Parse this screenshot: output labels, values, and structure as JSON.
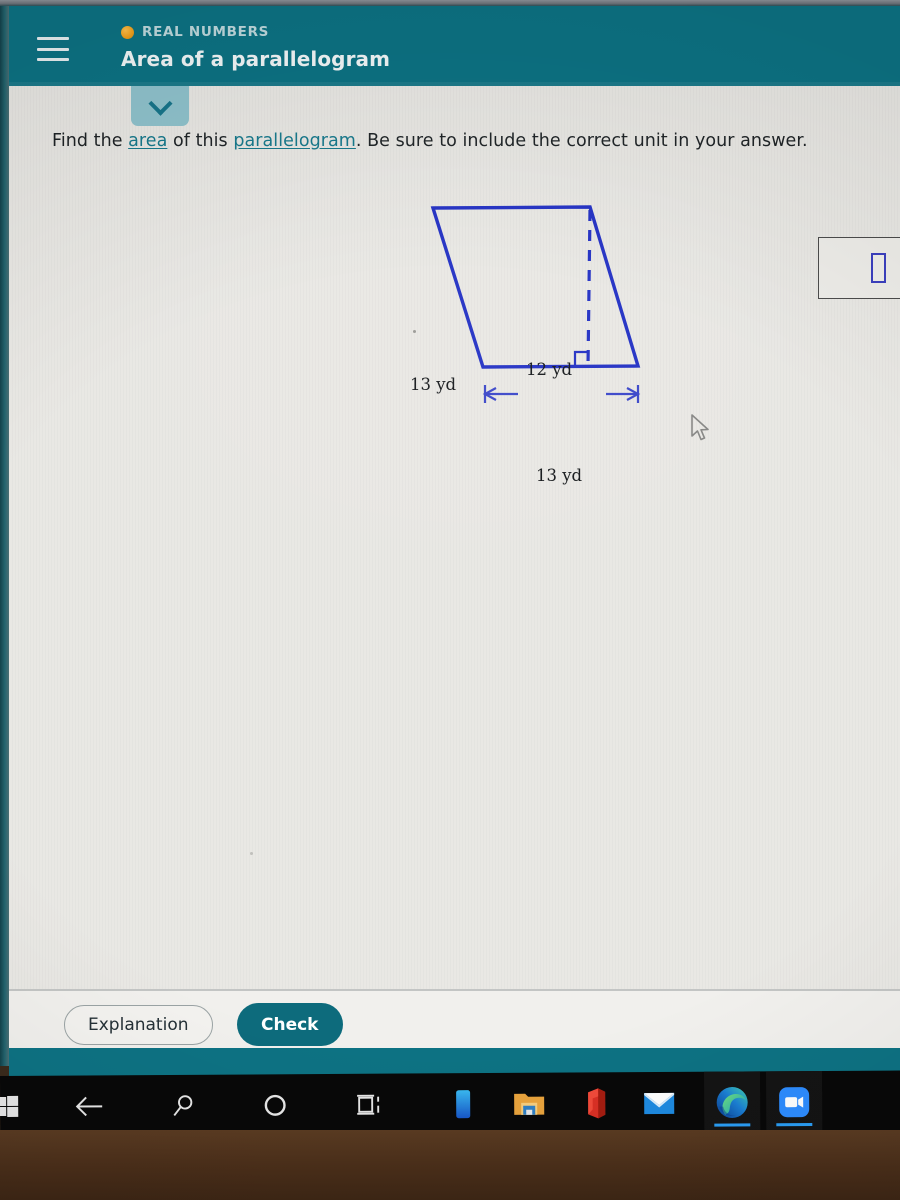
{
  "header": {
    "kicker": "REAL NUMBERS",
    "kicker_icon": "orange-circle-icon",
    "title": "Area of a parallelogram",
    "menu_icon": "hamburger-menu-icon",
    "bg_color": "#0d7283"
  },
  "tab": {
    "icon": "chevron-down-icon",
    "bg_color": "#8fc2cc"
  },
  "prompt": {
    "part1": "Find the ",
    "link1": "area",
    "part2": " of this ",
    "link2": "parallelogram",
    "part3": ". Be sure to include the correct unit in your answer.",
    "link_color": "#17798c"
  },
  "figure": {
    "shape": "parallelogram",
    "stroke_color": "#2331c4",
    "side_label": "13 yd",
    "height_label": "12 yd",
    "base_label": "13 yd",
    "right_angle_marker": "right-angle-icon",
    "height_line_style": "dashed",
    "dimension_arrows": "double-headed-arrow"
  },
  "answer": {
    "value": "",
    "placeholder": "",
    "caret_color": "#3b3fbe"
  },
  "actions": {
    "explanation_label": "Explanation",
    "check_label": "Check",
    "check_bg": "#0d6b7c"
  },
  "taskbar": {
    "items": [
      {
        "name": "windows-start-icon",
        "label": "Start"
      },
      {
        "name": "back-arrow-icon",
        "label": "Back"
      },
      {
        "name": "search-icon",
        "label": "Search"
      },
      {
        "name": "cortana-circle-icon",
        "label": "Cortana"
      },
      {
        "name": "task-view-icon",
        "label": "Task View"
      },
      {
        "name": "your-phone-icon",
        "label": "Your Phone"
      },
      {
        "name": "file-explorer-icon",
        "label": "File Explorer"
      },
      {
        "name": "microsoft-office-icon",
        "label": "Office"
      },
      {
        "name": "mail-icon",
        "label": "Mail"
      },
      {
        "name": "microsoft-edge-icon",
        "label": "Microsoft Edge",
        "active": true
      },
      {
        "name": "zoom-video-icon",
        "label": "Zoom",
        "active": true
      }
    ]
  },
  "chart_data": {
    "type": "diagram",
    "shape": "parallelogram",
    "title": "Area of a parallelogram",
    "labels": [
      {
        "text": "13 yd",
        "role": "slant-side"
      },
      {
        "text": "12 yd",
        "role": "height"
      },
      {
        "text": "13 yd",
        "role": "base"
      }
    ],
    "units": "yd",
    "base": 13,
    "height": 12,
    "slant_side": 13
  }
}
